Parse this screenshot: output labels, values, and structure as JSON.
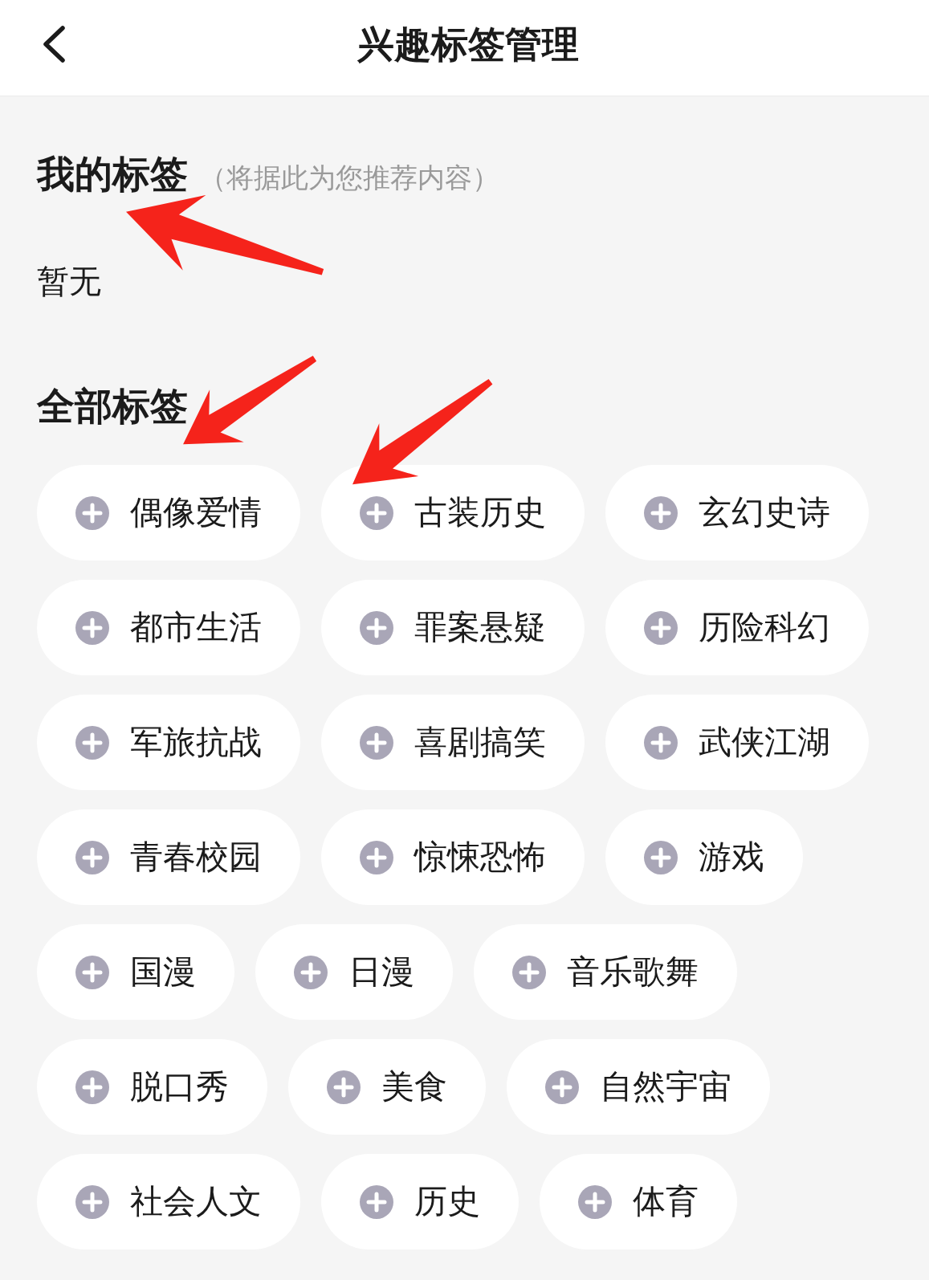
{
  "header": {
    "title": "兴趣标签管理"
  },
  "my_tags": {
    "title": "我的标签",
    "subtitle": "（将据此为您推荐内容）",
    "empty_text": "暂无"
  },
  "all_tags": {
    "title": "全部标签",
    "tags": [
      "偶像爱情",
      "古装历史",
      "玄幻史诗",
      "都市生活",
      "罪案悬疑",
      "历险科幻",
      "军旅抗战",
      "喜剧搞笑",
      "武侠江湖",
      "青春校园",
      "惊悚恐怖",
      "游戏",
      "国漫",
      "日漫",
      "音乐歌舞",
      "脱口秀",
      "美食",
      "自然宇宙",
      "社会人文",
      "历史",
      "体育"
    ]
  }
}
